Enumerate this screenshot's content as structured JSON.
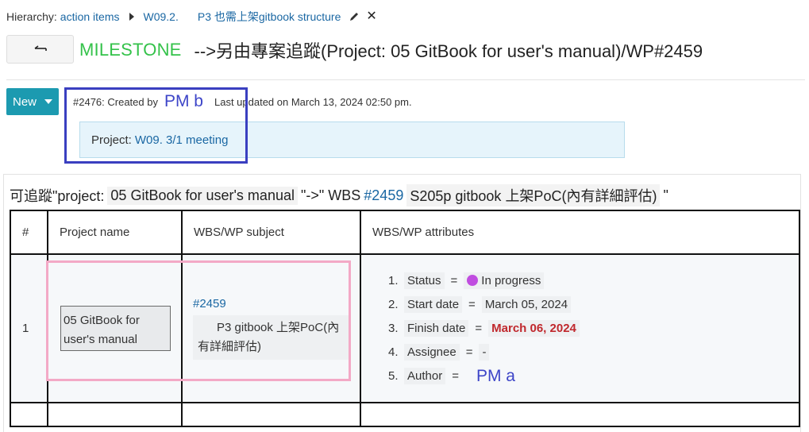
{
  "breadcrumb": {
    "label": "Hierarchy:",
    "root": "action items",
    "parent": "W09.2.",
    "current": "P3 也需上架gitbook structure"
  },
  "header": {
    "back_icon": "back-arrow-icon",
    "type_label": "MILESTONE",
    "title": "-->另由專案追蹤(Project: 05 GitBook for user's manual)/WP#2459"
  },
  "toolbar": {
    "new_label": "New"
  },
  "meta": {
    "id_created": "#2476: Created by",
    "creator": "PM b",
    "updated": "Last updated on March 13, 2024 02:50 pm."
  },
  "project": {
    "label": "Project:",
    "name": "W09. 3/1 meeting"
  },
  "trace": {
    "prefix": "可追蹤\"project:",
    "project_name": "05 GitBook for user's manual",
    "middle": "\"->\" WBS",
    "wp_link": "#2459",
    "wp_subject": "S205p gitbook 上架PoC(內有詳細評估)",
    "suffix": "\""
  },
  "table": {
    "headers": [
      "#",
      "Project name",
      "WBS/WP subject",
      "WBS/WP attributes"
    ],
    "row": {
      "num": "1",
      "project_name_line1": "05 GitBook for",
      "project_name_line2": "user's manual",
      "wp_link": "#2459",
      "wp_subject_line1": "P3 gitbook 上架PoC(內",
      "wp_subject_line2": "有詳細評估)"
    },
    "attributes": [
      {
        "n": "1.",
        "key": "Status",
        "value": "In progress",
        "color": "#c04de0"
      },
      {
        "n": "2.",
        "key": "Start date",
        "value": "March 05, 2024"
      },
      {
        "n": "3.",
        "key": "Finish date",
        "value": "March 06, 2024",
        "color": "#c0282d"
      },
      {
        "n": "4.",
        "key": "Assignee",
        "value": "-"
      },
      {
        "n": "5.",
        "key": "Author",
        "value": "PM a"
      }
    ],
    "eq": "="
  },
  "colors": {
    "milestone": "#34c24a",
    "link": "#1a67a3",
    "button": "#1c9ab0",
    "annotation_blue": "#3a3fc0",
    "annotation_pink": "#f3a9c6"
  }
}
